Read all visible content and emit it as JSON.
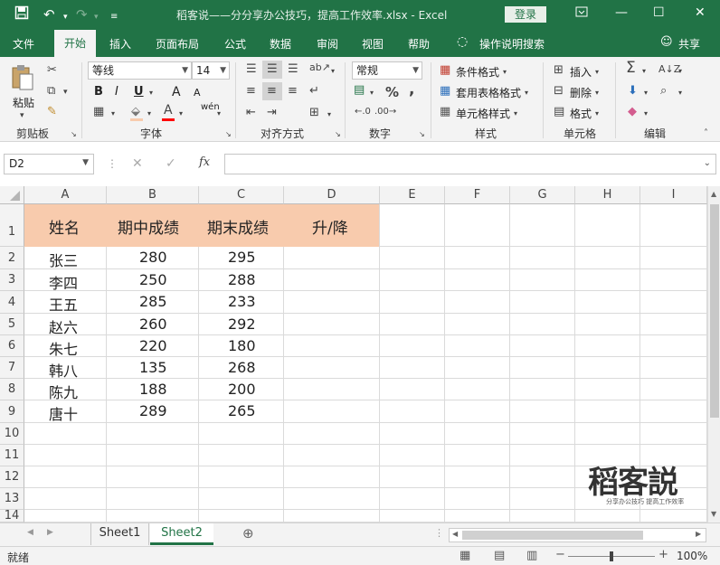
{
  "titlebar": {
    "title": "稻客说——分分享办公技巧，提高工作效率.xlsx  -  Excel",
    "login": "登录"
  },
  "menu": {
    "items": [
      "文件",
      "开始",
      "插入",
      "页面布局",
      "公式",
      "数据",
      "审阅",
      "视图",
      "帮助"
    ],
    "tell_me": "操作说明搜索",
    "share": "共享"
  },
  "ribbon": {
    "clipboard": {
      "paste": "粘贴",
      "label": "剪贴板"
    },
    "font": {
      "name": "等线",
      "size": "14",
      "bold": "B",
      "italic": "I",
      "underline": "U",
      "grow": "A",
      "shrink": "A",
      "wen": "wén",
      "label": "字体",
      "accent_color": "#ff0000"
    },
    "alignment": {
      "label": "对齐方式"
    },
    "number": {
      "format": "常规",
      "percent": "%",
      "comma": ",",
      "label": "数字"
    },
    "styles": {
      "conditional": "条件格式",
      "table": "套用表格格式",
      "cell": "单元格样式",
      "label": "样式"
    },
    "cells": {
      "insert": "插入",
      "delete": "删除",
      "format": "格式",
      "label": "单元格"
    },
    "editing": {
      "label": "编辑"
    }
  },
  "formula": {
    "namebox": "D2",
    "fx": "fx",
    "value": ""
  },
  "sheet": {
    "columns": [
      "A",
      "B",
      "C",
      "D",
      "E",
      "F",
      "G",
      "H",
      "I"
    ],
    "rows": [
      "1",
      "2",
      "3",
      "4",
      "5",
      "6",
      "7",
      "8",
      "9",
      "10",
      "11",
      "12",
      "13",
      "14"
    ],
    "header": [
      "姓名",
      "期中成绩",
      "期末成绩",
      "升/降"
    ],
    "data": [
      [
        "张三",
        "280",
        "295"
      ],
      [
        "李四",
        "250",
        "288"
      ],
      [
        "王五",
        "285",
        "233"
      ],
      [
        "赵六",
        "260",
        "292"
      ],
      [
        "朱七",
        "220",
        "180"
      ],
      [
        "韩八",
        "135",
        "268"
      ],
      [
        "陈九",
        "188",
        "200"
      ],
      [
        "唐十",
        "289",
        "265"
      ]
    ],
    "header_fill": "#f8cbad"
  },
  "watermark": {
    "logo": "稻客説",
    "slogan": "分享办公技巧  提高工作效率"
  },
  "tabs": {
    "sheet1": "Sheet1",
    "sheet2": "Sheet2"
  },
  "status": {
    "ready": "就绪",
    "zoom": "100%"
  },
  "colors": {
    "brand": "#217346"
  }
}
